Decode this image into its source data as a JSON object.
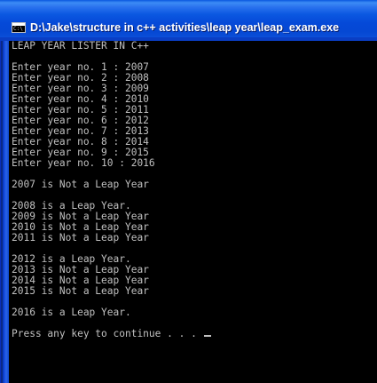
{
  "window": {
    "title": "D:\\Jake\\structure in c++ activities\\leap year\\leap_exam.exe",
    "icon": "console-app-icon"
  },
  "console": {
    "lines": [
      "LEAP YEAR LISTER IN C++",
      "",
      "Enter year no. 1 : 2007",
      "Enter year no. 2 : 2008",
      "Enter year no. 3 : 2009",
      "Enter year no. 4 : 2010",
      "Enter year no. 5 : 2011",
      "Enter year no. 6 : 2012",
      "Enter year no. 7 : 2013",
      "Enter year no. 8 : 2014",
      "Enter year no. 9 : 2015",
      "Enter year no. 10 : 2016",
      "",
      "2007 is Not a Leap Year",
      "",
      "2008 is a Leap Year.",
      "2009 is Not a Leap Year",
      "2010 is Not a Leap Year",
      "2011 is Not a Leap Year",
      "",
      "2012 is a Leap Year.",
      "2013 is Not a Leap Year",
      "2014 is Not a Leap Year",
      "2015 is Not a Leap Year",
      "",
      "2016 is a Leap Year.",
      "",
      "Press any key to continue . . . "
    ]
  },
  "colors": {
    "console_background": "#000000",
    "console_text": "#c0c0c0",
    "titlebar": "#0549d8",
    "title_text": "#ffffff"
  }
}
